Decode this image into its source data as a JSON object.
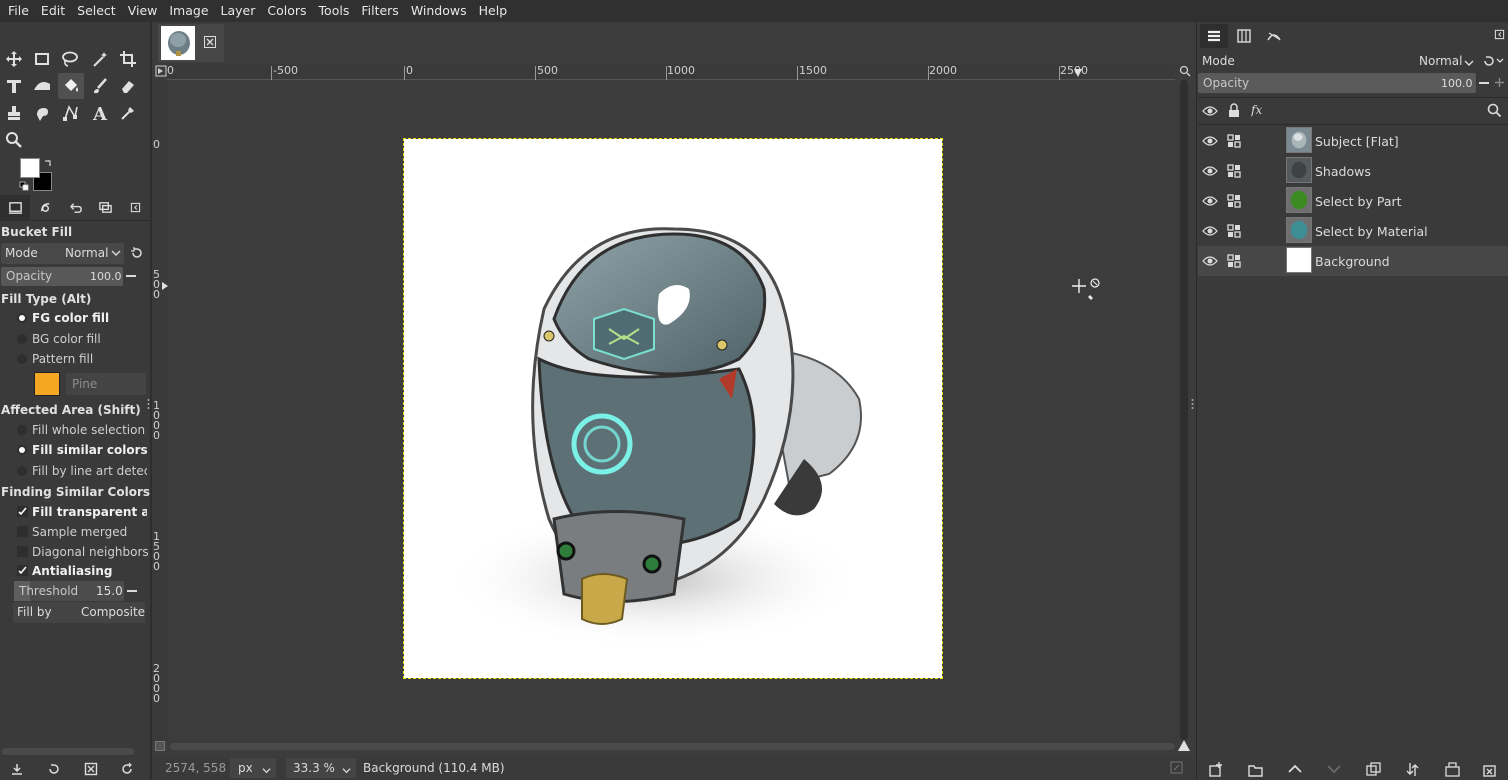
{
  "menubar": [
    "File",
    "Edit",
    "Select",
    "View",
    "Image",
    "Layer",
    "Colors",
    "Tools",
    "Filters",
    "Windows",
    "Help"
  ],
  "tool_options": {
    "title": "Bucket Fill",
    "mode_label": "Mode",
    "mode_value": "Normal",
    "opacity_label": "Opacity",
    "opacity_value": "100.0",
    "fill_type_title": "Fill Type  (Alt)",
    "fill_type_options": [
      "FG color fill",
      "BG color fill",
      "Pattern fill"
    ],
    "pattern_name": "Pine",
    "affected_area_title": "Affected Area  (Shift)",
    "affected_area_options": [
      "Fill whole selection",
      "Fill similar colors",
      "Fill by line art detectio"
    ],
    "finding_title": "Finding Similar Colors",
    "checks": [
      "Fill transparent areas",
      "Sample merged",
      "Diagonal neighbors",
      "Antialiasing"
    ],
    "threshold_label": "Threshold",
    "threshold_value": "15.0",
    "fill_by_label": "Fill by",
    "fill_by_value": "Composite"
  },
  "ruler": {
    "h_labels": [
      "0",
      "-500",
      "0",
      "500",
      "1000",
      "1500",
      "2000",
      "2500"
    ],
    "v_labels": [
      [
        "0"
      ],
      [
        "5",
        "0",
        "0"
      ],
      [
        "1",
        "0",
        "0",
        "0"
      ],
      [
        "1",
        "5",
        "0",
        "0"
      ],
      [
        "2",
        "0",
        "0",
        "0"
      ]
    ]
  },
  "status": {
    "coords": "2574, 558",
    "unit": "px",
    "zoom": "33.3 %",
    "info": "Background (110.4 MB)"
  },
  "layers_panel": {
    "mode_label": "Mode",
    "mode_value": "Normal",
    "opacity_label": "Opacity",
    "opacity_value": "100.0",
    "layers": [
      {
        "name": "Subject [Flat]",
        "thumb": "#7a8a90"
      },
      {
        "name": "Shadows",
        "thumb": "#555a5c"
      },
      {
        "name": "Select by Part",
        "thumb": "#3c8a22"
      },
      {
        "name": "Select by Material",
        "thumb": "#3e8f95"
      },
      {
        "name": "Background",
        "thumb": "#ffffff"
      }
    ],
    "selected_layer": "Background"
  },
  "colors": {
    "fg": "#ffffff",
    "bg": "#000000",
    "selection_outline": "#e6e600"
  }
}
